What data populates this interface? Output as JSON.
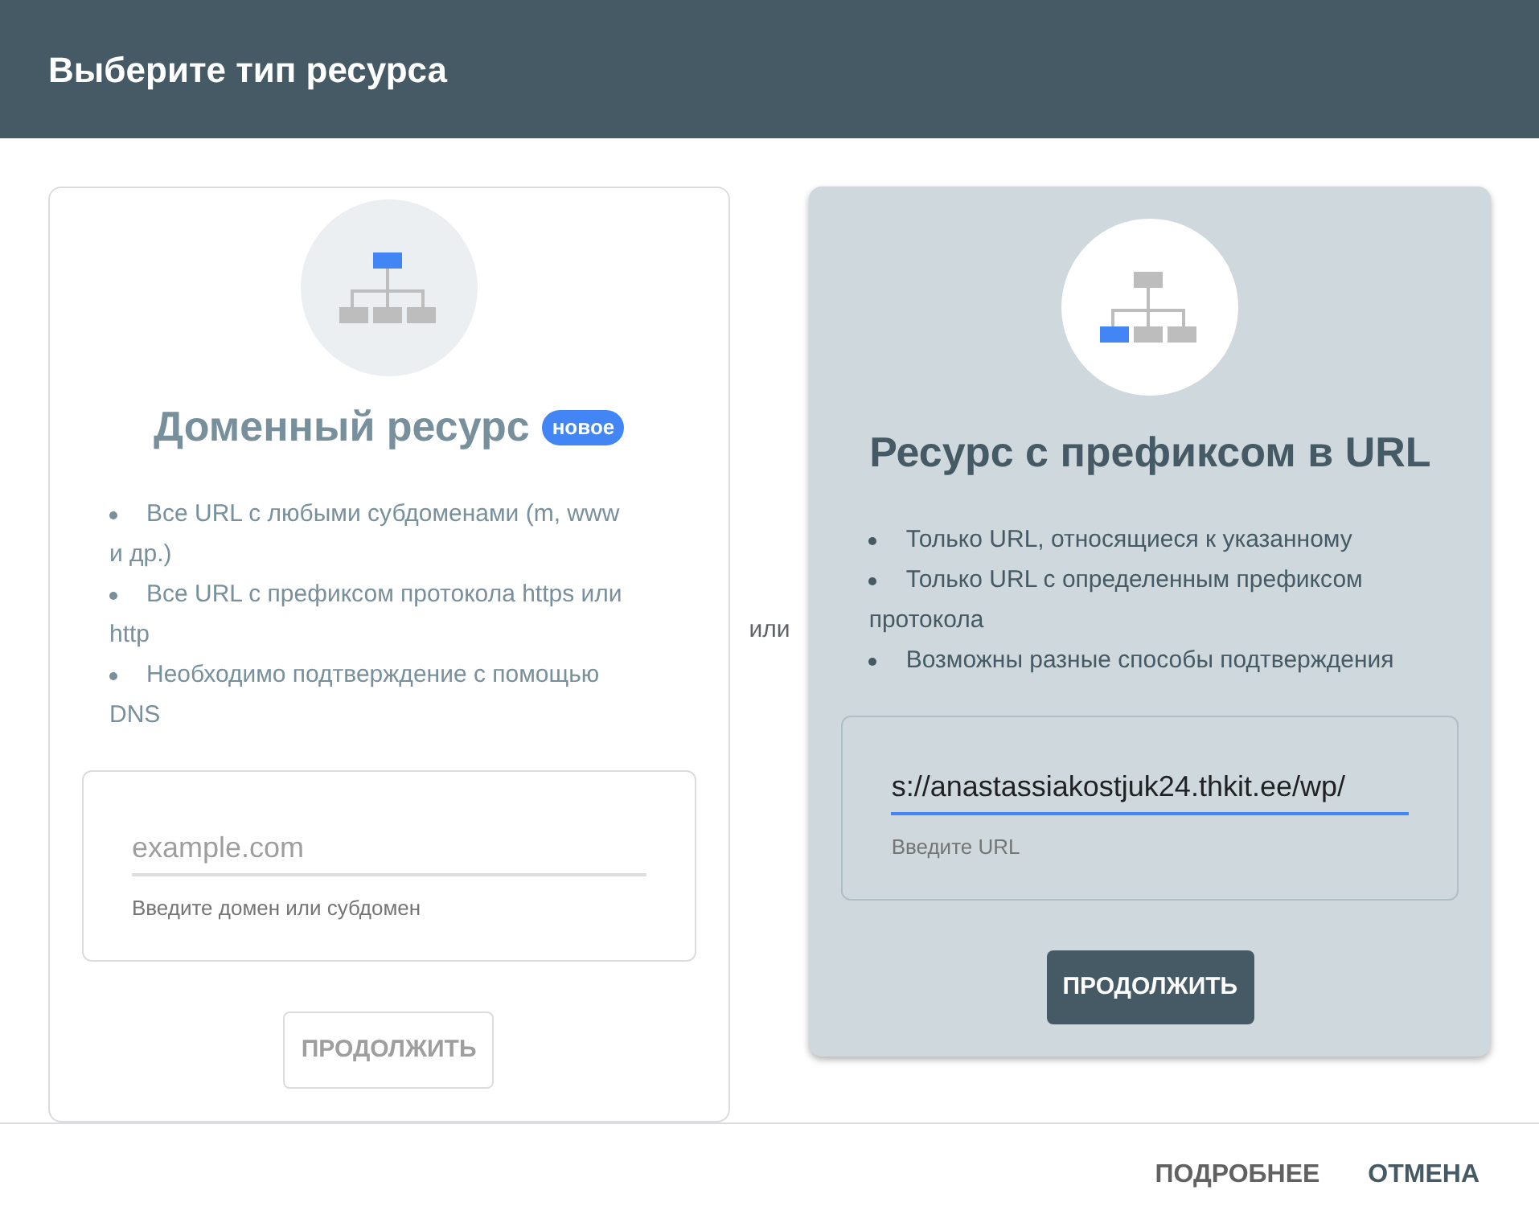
{
  "dialog": {
    "title": "Выберите тип ресурса"
  },
  "cards": [
    {
      "selected": false,
      "kind": "domain",
      "title": "Доменный ресурс",
      "badge": "новое",
      "bullets": [
        "Все URL с любыми субдоменами (m, www и др.)",
        "Все URL с префиксом протокола https или http",
        "Необходимо подтверждение с помощью DNS"
      ],
      "field": {
        "placeholder": "example.com",
        "hint": "Введите домен или субдомен",
        "focused": false
      },
      "button": {
        "label": "ПРОДОЛЖИТЬ",
        "disabled": true
      }
    },
    {
      "selected": true,
      "kind": "url_prefix",
      "title": "Ресурс с префиксом в URL",
      "bullets": [
        "Только URL, относящиеся к указанному",
        "Только URL с определенным префиксом протокола",
        "Возможны разные способы подтверждения"
      ],
      "field": {
        "value": "s://anastassiakostjuk24.thkit.ee/wp/",
        "hint": "Введите URL",
        "focused": true
      },
      "button": {
        "label": "ПРОДОЛЖИТЬ",
        "disabled": false
      }
    }
  ],
  "separator": "или",
  "footer": {
    "buttons": [
      "ПОДРОБНЕЕ",
      "ОТМЕНА"
    ]
  }
}
